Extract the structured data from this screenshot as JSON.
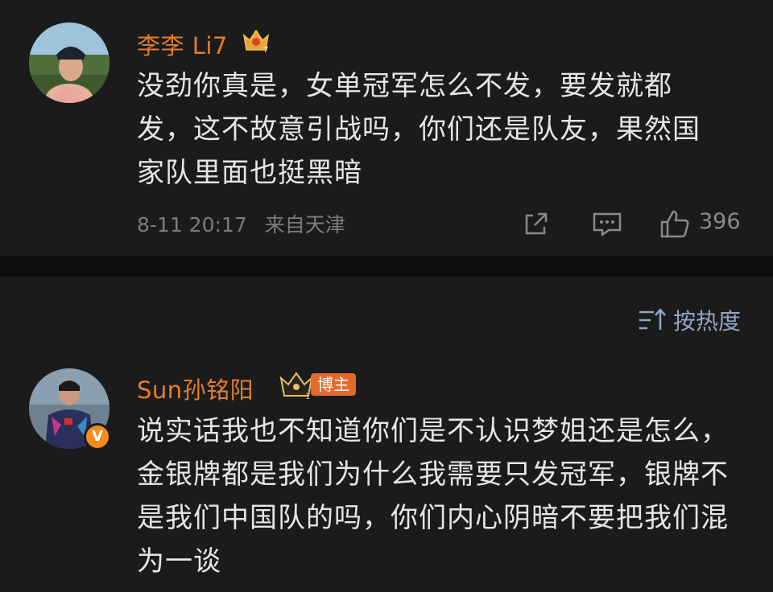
{
  "comments": [
    {
      "username": "李李 Li7",
      "text": "没劲你真是，女单冠军怎么不发，要发就都发，这不故意引战吗，你们还是队友，果然国家队里面也挺黑暗",
      "date": "8-11 20:17",
      "location": "来自天津",
      "likes": "396",
      "crown_level": "7",
      "icons": [
        "share-icon",
        "reply-icon",
        "like-icon"
      ]
    },
    {
      "username": "Sun孙铭阳",
      "badge": "博主",
      "verified": "V",
      "crown_level": "1",
      "text": "说实话我也不知道你们是不认识梦姐还是怎么，金银牌都是我们为什么我需要只发冠军，银牌不是我们中国队的吗，你们内心阴暗不要把我们混为一谈"
    }
  ],
  "sort": {
    "label": "按热度",
    "icon": "sort-icon"
  },
  "colors": {
    "background": "#161616",
    "card": "#1b1b1b",
    "username": "#e47e2c",
    "text": "#e6e6e6",
    "meta": "#7c7c7c",
    "sort": "#93a6c4",
    "badge": "#e26a2b"
  }
}
